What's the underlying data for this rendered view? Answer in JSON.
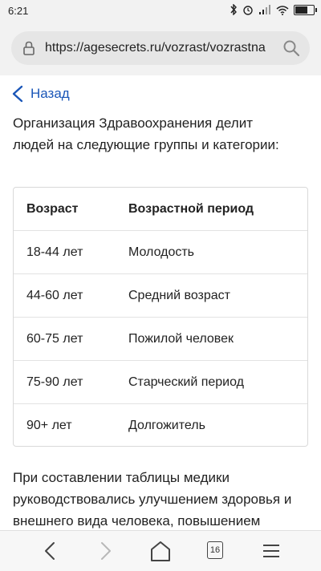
{
  "status_bar": {
    "time": "6:21",
    "battery_level_percent": 70,
    "icons": [
      "bluetooth-icon",
      "alarm-icon",
      "signal-icon",
      "wifi-icon",
      "battery-icon"
    ]
  },
  "browser": {
    "url": "https://agesecrets.ru/vozrast/vozrastna",
    "tabs_count": "16"
  },
  "page": {
    "back_label": "Назад",
    "intro_cut": "Организация Здравоохранения делит",
    "intro_line1": "Организация Здравоохранения делит",
    "intro_line2": "людей на следующие группы и категории:",
    "table": {
      "headers": [
        "Возраст",
        "Возрастной период"
      ],
      "rows": [
        [
          "18-44 лет",
          "Молодость"
        ],
        [
          "44-60 лет",
          "Средний возраст"
        ],
        [
          "60-75 лет",
          "Пожилой человек"
        ],
        [
          "75-90 лет",
          "Старческий период"
        ],
        [
          "90+ лет",
          "Долгожитель"
        ]
      ]
    },
    "paragraph": "При составлении таблицы медики руководствовались улучшением здоровья и внешнего вида человека, повышением"
  },
  "colors": {
    "link": "#1a56b8",
    "chrome_bg": "#f2f2f2",
    "url_bg": "#e6e6e6"
  }
}
